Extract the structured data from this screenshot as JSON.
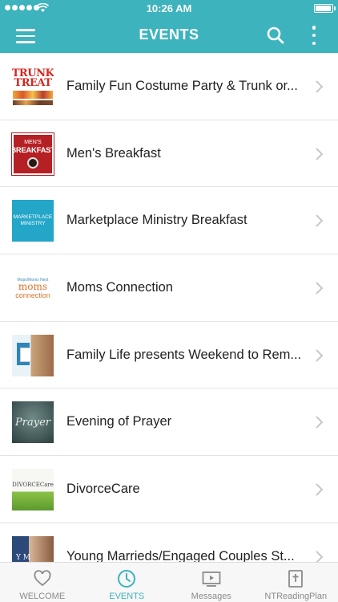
{
  "status_bar": {
    "time": "10:26 AM"
  },
  "nav": {
    "title": "EVENTS"
  },
  "events": [
    {
      "title": "Family Fun Costume Party & Trunk or...",
      "thumb": {
        "line1": "TRUNK",
        "line2": "TREAT"
      }
    },
    {
      "title": "Men's Breakfast",
      "thumb": {
        "line1": "MEN'S",
        "line2": "BREAKFAST"
      }
    },
    {
      "title": "Marketplace Ministry Breakfast",
      "thumb": {
        "line1": "MARKETPLACE",
        "line2": "MINISTRY"
      }
    },
    {
      "title": "Moms Connection",
      "thumb": {
        "line1": "Mops/Moms Next",
        "line2": "moms",
        "line3": "connection"
      }
    },
    {
      "title": "Family Life presents Weekend to Rem...",
      "thumb": {}
    },
    {
      "title": "Evening of Prayer",
      "thumb": {
        "line1": "Prayer"
      }
    },
    {
      "title": "DivorceCare",
      "thumb": {
        "line1": "DIVORCECare"
      }
    },
    {
      "title": "Young Marrieds/Engaged Couples St...",
      "thumb": {
        "line1": "Y M"
      }
    }
  ],
  "tabs": [
    {
      "label": "WELCOME",
      "icon": "heart-icon",
      "active": false
    },
    {
      "label": "EVENTS",
      "icon": "clock-icon",
      "active": true
    },
    {
      "label": "Messages",
      "icon": "play-video-icon",
      "active": false
    },
    {
      "label": "NTReadingPlan",
      "icon": "bible-icon",
      "active": false
    }
  ],
  "colors": {
    "accent": "#3db3bd",
    "tab_inactive": "#8a8a8a"
  }
}
